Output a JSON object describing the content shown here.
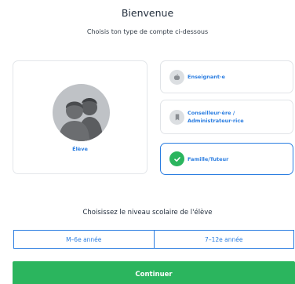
{
  "header": {
    "title": "Bienvenue",
    "subtitle": "Choisis ton type de compte ci-dessous"
  },
  "account_types": {
    "student": {
      "label": "Élève",
      "icon": "students-avatar-icon"
    },
    "teacher": {
      "label": "Enseignant·e",
      "icon": "apple-icon"
    },
    "counselor": {
      "label": "Conseilleur·ère / Administrateur·rice",
      "icon": "bookmark-icon"
    },
    "family": {
      "label": "Famille/Tuteur",
      "icon": "check-icon",
      "selected": true
    }
  },
  "level": {
    "title": "Choisissez le niveau scolaire de l'élève",
    "options": [
      "M–6e année",
      "7–12e année"
    ]
  },
  "continue_label": "Continuer",
  "colors": {
    "accent": "#2a7de1",
    "success": "#2bb55e",
    "avatar": "#bfc2c6"
  }
}
